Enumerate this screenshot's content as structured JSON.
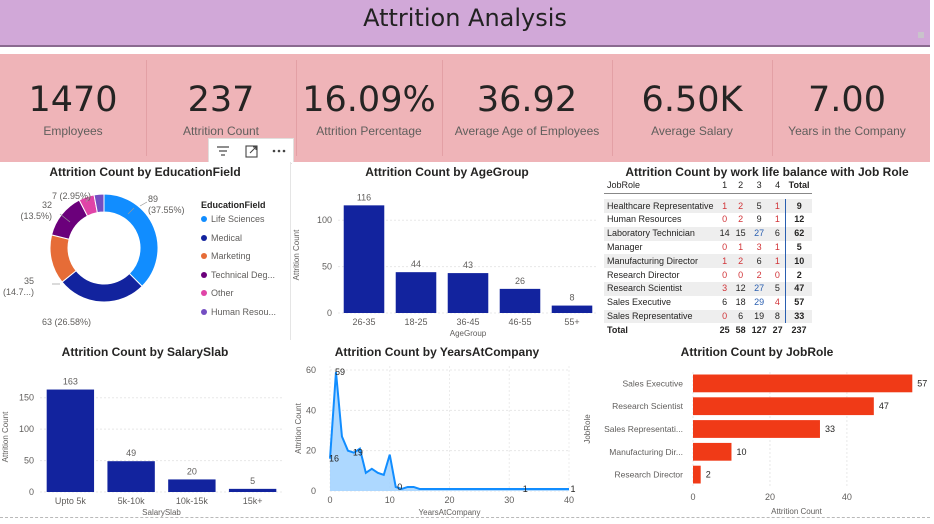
{
  "header": {
    "title": "Attrition Analysis"
  },
  "kpis": [
    {
      "value": "1470",
      "label": "Employees"
    },
    {
      "value": "237",
      "label": "Attrition Count"
    },
    {
      "value": "16.09%",
      "label": "Attrition Percentage"
    },
    {
      "value": "36.92",
      "label": "Average Age of Employees"
    },
    {
      "value": "6.50K",
      "label": "Average Salary"
    },
    {
      "value": "7.00",
      "label": "Years in the Company"
    }
  ],
  "toolbar": {
    "filter_icon": "filter-icon",
    "focus_icon": "focus-mode-icon",
    "more_icon": "more-options-icon"
  },
  "colors": {
    "bar_blue": "#12239e",
    "bar_red": "#f03a17",
    "line_blue": "#118dff",
    "area_fill": "#9fd1ff",
    "kpi_bg": "#efb4b8",
    "title_bg": "#d1a8d8"
  },
  "chart_data": [
    {
      "id": "education",
      "type": "pie",
      "title": "Attrition Count by EducationField",
      "legend_title": "EducationField",
      "legend_position": "right",
      "slices": [
        {
          "name": "Life Sciences",
          "value": 89,
          "label": "89",
          "pct_label": "(37.55%)",
          "color": "#118dff"
        },
        {
          "name": "Medical",
          "value": 63,
          "label": "63 (26.58%)",
          "pct_label": "",
          "color": "#12239e"
        },
        {
          "name": "Marketing",
          "value": 35,
          "label": "35",
          "pct_label": "(14.7...)",
          "color": "#e66c37"
        },
        {
          "name": "Technical Deg...",
          "value": 32,
          "label": "32",
          "pct_label": "(13.5%)",
          "color": "#6b007b"
        },
        {
          "name": "Other",
          "value": 11,
          "label": "",
          "pct_label": "",
          "color": "#e044a7"
        },
        {
          "name": "Human Resou...",
          "value": 7,
          "label": "7 (2.95%)",
          "pct_label": "",
          "color": "#744ec2"
        }
      ]
    },
    {
      "id": "agegroup",
      "type": "bar",
      "title": "Attrition Count by AgeGroup",
      "categories": [
        "26-35",
        "18-25",
        "36-45",
        "46-55",
        "55+"
      ],
      "values": [
        116,
        44,
        43,
        26,
        8
      ],
      "xlabel": "AgeGroup",
      "ylabel": "Attrition Count",
      "yticks": [
        "0",
        "50",
        "100"
      ],
      "ylim": [
        0,
        125
      ],
      "grid": true
    },
    {
      "id": "worklife",
      "type": "table",
      "title": "Attrition Count by work life balance with Job Role",
      "columns": [
        "JobRole",
        "1",
        "2",
        "3",
        "4",
        "Total"
      ],
      "rows": [
        [
          "Healthcare Representative",
          "1",
          "2",
          "5",
          "1",
          "9"
        ],
        [
          "Human Resources",
          "0",
          "2",
          "9",
          "1",
          "12"
        ],
        [
          "Laboratory Technician",
          "14",
          "15",
          "27",
          "6",
          "62"
        ],
        [
          "Manager",
          "0",
          "1",
          "3",
          "1",
          "5"
        ],
        [
          "Manufacturing Director",
          "1",
          "2",
          "6",
          "1",
          "10"
        ],
        [
          "Research Director",
          "0",
          "0",
          "2",
          "0",
          "2"
        ],
        [
          "Research Scientist",
          "3",
          "12",
          "27",
          "5",
          "47"
        ],
        [
          "Sales Executive",
          "6",
          "18",
          "29",
          "4",
          "57"
        ],
        [
          "Sales Representative",
          "0",
          "6",
          "19",
          "8",
          "33"
        ]
      ],
      "total_row": [
        "Total",
        "25",
        "58",
        "127",
        "27",
        "237"
      ]
    },
    {
      "id": "salaryslab",
      "type": "bar",
      "title": "Attrition Count by SalarySlab",
      "categories": [
        "Upto 5k",
        "5k-10k",
        "10k-15k",
        "15k+"
      ],
      "values": [
        163,
        49,
        20,
        5
      ],
      "xlabel": "SalarySlab",
      "ylabel": "Attrition Count",
      "yticks": [
        "0",
        "50",
        "100",
        "150"
      ],
      "ylim": [
        0,
        175
      ],
      "grid": true
    },
    {
      "id": "yearsatcompany",
      "type": "area",
      "title": "Attrition Count by YearsAtCompany",
      "x": [
        0,
        1,
        2,
        3,
        4,
        5,
        6,
        7,
        8,
        9,
        10,
        11,
        12,
        13,
        14,
        15,
        16,
        17,
        18,
        19,
        20,
        21,
        22,
        23,
        24,
        25,
        26,
        27,
        28,
        29,
        30,
        31,
        32,
        33,
        34,
        35,
        36,
        37,
        38,
        39,
        40
      ],
      "y": [
        16,
        59,
        27,
        20,
        19,
        21,
        9,
        11,
        9,
        8,
        18,
        2,
        1,
        2,
        2,
        1,
        1,
        1,
        1,
        1,
        1,
        1,
        1,
        1,
        1,
        1,
        1,
        1,
        1,
        1,
        1,
        1,
        1,
        1,
        1,
        1,
        1,
        1,
        1,
        1,
        1
      ],
      "data_labels": [
        {
          "x": 0,
          "y": 16,
          "text": "16"
        },
        {
          "x": 1,
          "y": 59,
          "text": "59"
        },
        {
          "x": 4,
          "y": 19,
          "text": "19"
        },
        {
          "x": 11,
          "y": 2,
          "text": "0"
        },
        {
          "x": 32,
          "y": 1,
          "text": "1"
        },
        {
          "x": 40,
          "y": 1,
          "text": "1"
        }
      ],
      "xlabel": "YearsAtCompany",
      "ylabel": "Attrition Count",
      "xticks": [
        "0",
        "10",
        "20",
        "30",
        "40"
      ],
      "yticks": [
        "0",
        "20",
        "40",
        "60"
      ],
      "xlim": [
        0,
        40
      ],
      "ylim": [
        0,
        62
      ],
      "grid": true
    },
    {
      "id": "jobrole",
      "type": "bar",
      "orientation": "horizontal",
      "title": "Attrition Count by JobRole",
      "categories": [
        "Sales Executive",
        "Research Scientist",
        "Sales Representati...",
        "Manufacturing Dir...",
        "Research Director"
      ],
      "values": [
        57,
        47,
        33,
        10,
        2
      ],
      "xlabel": "Attrition Count",
      "ylabel": "JobRole",
      "xticks": [
        "0",
        "20",
        "40"
      ],
      "xlim": [
        0,
        59
      ],
      "grid": true
    }
  ]
}
